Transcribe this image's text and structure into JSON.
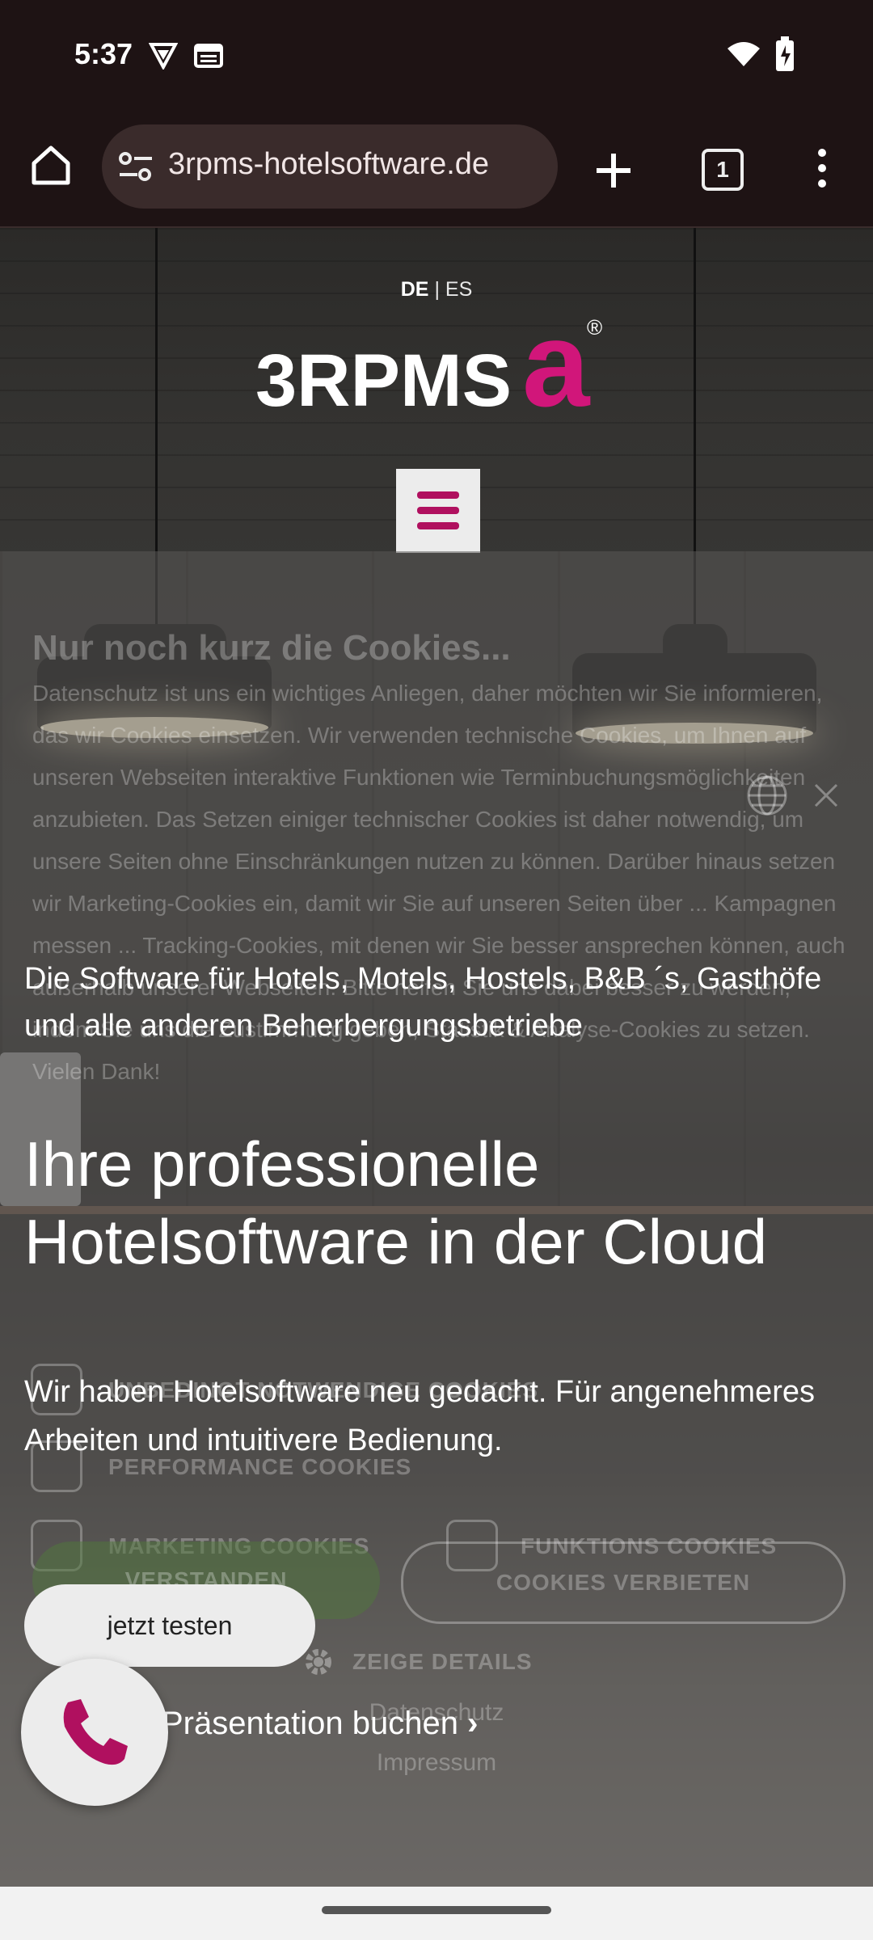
{
  "status_bar": {
    "time": "5:37"
  },
  "browser": {
    "url": "3rpms-hotelsoftware.de",
    "tab_count": "1"
  },
  "site": {
    "lang_active": "DE",
    "lang_sep": "|",
    "lang_other": "ES",
    "logo_text": "3RPMS",
    "logo_mark": "a",
    "logo_reg": "®"
  },
  "cookie": {
    "title": "Nur noch kurz die Cookies...",
    "text": "Datenschutz ist uns ein wichtiges Anliegen, daher möchten wir Sie informieren, das wir Cookies einsetzen. Wir verwenden technische Cookies, um Ihnen auf unseren Webseiten interaktive Funktionen wie Terminbuchungsmöglichkeiten anzubieten. Das Setzen einiger technischer Cookies ist daher notwendig, um unsere Seiten ohne Einschränkungen nutzen zu können. Darüber hinaus setzen wir Marketing-Cookies ein, damit wir Sie auf unseren Seiten über ... Kampagnen messen ... Tracking-Cookies, mit denen wir Sie besser ansprechen können, auch außerhalb unserer Webseiten. Bitte helfen Sie uns dabei besser zu werden, indem Sie uns die Zustimmung geben, Statistik & Analyse-Cookies zu setzen. Vielen Dank!",
    "opt_necessary": "UNBEDINGT NOTWENDIGE COOKIES",
    "opt_performance": "PERFORMANCE COOKIES",
    "opt_marketing": "MARKETING COOKIES",
    "opt_functional": "FUNKTIONS COOKIES",
    "accept_label": "VERSTANDEN",
    "deny_label": "COOKIES VERBIETEN",
    "details_label": "ZEIGE DETAILS",
    "privacy_link": "Datenschutz",
    "imprint_link": "Impressum"
  },
  "hero": {
    "tagline": "Die Software für Hotels, Motels, Hostels, B&B ´s, Gasthöfe und alle anderen Beherbergungsbetriebe",
    "headline": "Ihre professionelle Hotelsoftware in der Cloud",
    "intro": "Wir haben Hotelsoftware neu gedacht. Für angenehmeres Arbeiten und intuitivere Bedienung.",
    "try_button": "jetzt testen",
    "demo_link": "Präsentation buchen"
  },
  "colors": {
    "brand": "#b0105f",
    "status_bg": "#1e1314"
  }
}
